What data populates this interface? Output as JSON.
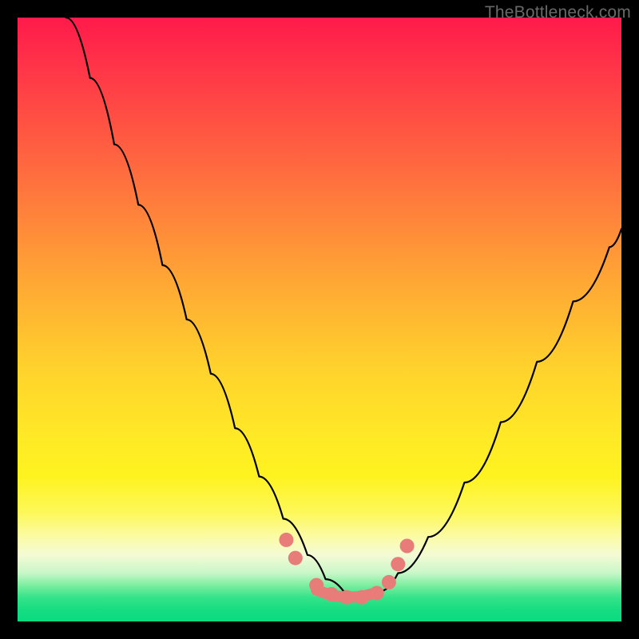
{
  "watermark": "TheBottleneck.com",
  "chart_data": {
    "type": "line",
    "title": "",
    "xlabel": "",
    "ylabel": "",
    "xlim": [
      0,
      100
    ],
    "ylim": [
      0,
      100
    ],
    "grid": false,
    "axes_visible": false,
    "note": "Axes are not labeled in the image; x/y values below are estimated in percent-of-plot coordinates (y = 100 at top, 0 at bottom).",
    "series": [
      {
        "name": "bottleneck-curve",
        "color": "#000000",
        "x": [
          8,
          12,
          16,
          20,
          24,
          28,
          32,
          36,
          40,
          44,
          48,
          51,
          54,
          57,
          60,
          63,
          68,
          74,
          80,
          86,
          92,
          98,
          100
        ],
        "y": [
          100,
          90,
          79,
          69,
          59,
          50,
          41,
          32,
          24,
          17,
          11,
          7,
          5,
          4,
          5,
          8,
          14,
          23,
          33,
          43,
          53,
          62,
          65
        ]
      },
      {
        "name": "sweet-spot-markers",
        "type": "scatter",
        "color": "#e77c78",
        "x": [
          44.5,
          46.0,
          49.5,
          52.0,
          54.5,
          57.0,
          59.5,
          61.5,
          63.0,
          64.5
        ],
        "y": [
          13.5,
          10.5,
          6.0,
          4.5,
          4.0,
          4.0,
          4.7,
          6.5,
          9.5,
          12.5
        ]
      },
      {
        "name": "sweet-spot-band",
        "type": "line",
        "color": "#e77c78",
        "x": [
          49.5,
          52.0,
          54.5,
          57.0,
          59.5
        ],
        "y": [
          5.2,
          4.3,
          4.0,
          4.1,
          4.8
        ]
      }
    ]
  }
}
